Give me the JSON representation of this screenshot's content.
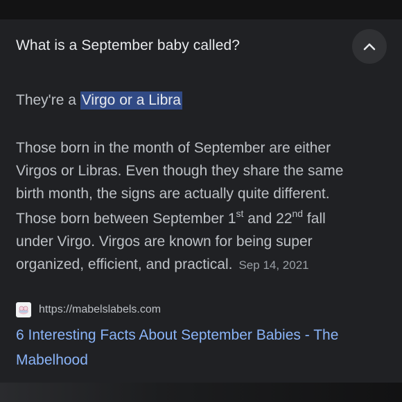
{
  "question": "What is a September baby called?",
  "collapse_icon": "chevron-up-icon",
  "short_answer": {
    "prefix": "They're a ",
    "highlight": "Virgo or a Libra"
  },
  "long_answer": {
    "line1": "Those born in the month of September are either",
    "line2": "Virgos or Libras. Even though they share the same",
    "line3": "birth month, the signs are actually quite different.",
    "line4_a": "Those born between September 1",
    "line4_sup1": "st",
    "line4_b": " and 22",
    "line4_sup2": "nd",
    "line4_c": " fall",
    "line5": "under Virgo. Virgos are known for being super",
    "line6": "organized, efficient, and practical.",
    "date": "Sep 14, 2021"
  },
  "source": {
    "favicon_icon": "mabels-labels-favicon-icon",
    "url": "https://mabelslabels.com"
  },
  "result_title": "6 Interesting Facts About September Babies - The Mabelhood",
  "colors": {
    "card_bg": "#202124",
    "text_primary": "#e8eaed",
    "text_secondary": "#bdc1c6",
    "highlight_bg": "#314a85",
    "link": "#8ab4f8"
  }
}
